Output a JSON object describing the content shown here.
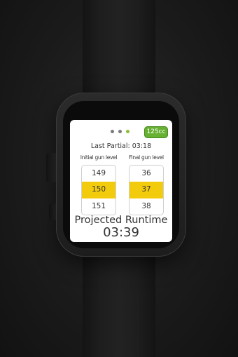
{
  "screen": {
    "page_dots": [
      {
        "active": false
      },
      {
        "active": false
      },
      {
        "active": true
      }
    ],
    "badge_label": "125cc",
    "last_partial": "Last Partial: 03:18",
    "initial_gun": {
      "label": "Initial gun level",
      "values": [
        "149",
        "150",
        "151"
      ],
      "selected_index": 1
    },
    "final_gun": {
      "label": "Final gun level",
      "values": [
        "36",
        "37",
        "38"
      ],
      "selected_index": 1
    },
    "projected_label": "Projected Runtime",
    "projected_time": "03:39"
  },
  "colors": {
    "badge": "#66b032",
    "selection": "#f2cc0c",
    "active_dot": "#8bbf3a"
  }
}
